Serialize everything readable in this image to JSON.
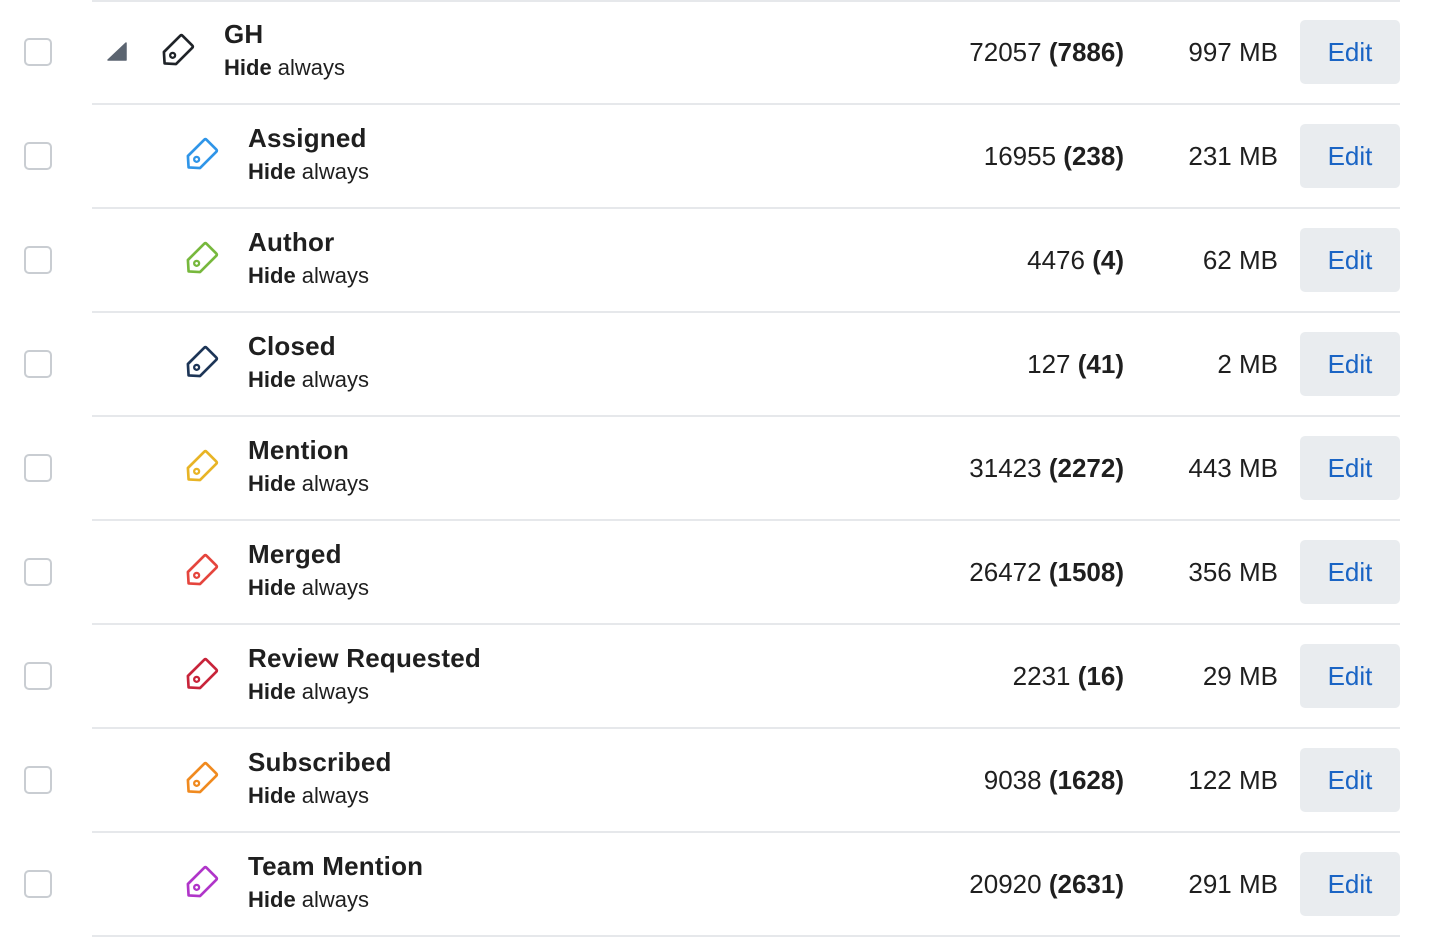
{
  "labels": [
    {
      "name": "GH",
      "visibility_strong": "Hide",
      "visibility_rest": " always",
      "count": "72057",
      "unread": "(7886)",
      "size": "997 MB",
      "edit_label": "Edit",
      "icon": "tag-outline-icon",
      "icon_color": "#1f2328",
      "is_parent": true
    },
    {
      "name": "Assigned",
      "visibility_strong": "Hide",
      "visibility_rest": " always",
      "count": "16955",
      "unread": "(238)",
      "size": "231 MB",
      "edit_label": "Edit",
      "icon": "tag-outline-icon",
      "icon_color": "#2f95e8",
      "is_parent": false
    },
    {
      "name": "Author",
      "visibility_strong": "Hide",
      "visibility_rest": " always",
      "count": "4476",
      "unread": "(4)",
      "size": "62 MB",
      "edit_label": "Edit",
      "icon": "tag-outline-icon",
      "icon_color": "#77b83d",
      "is_parent": false
    },
    {
      "name": "Closed",
      "visibility_strong": "Hide",
      "visibility_rest": " always",
      "count": "127",
      "unread": "(41)",
      "size": "2 MB",
      "edit_label": "Edit",
      "icon": "tag-outline-icon",
      "icon_color": "#1d3557",
      "is_parent": false
    },
    {
      "name": "Mention",
      "visibility_strong": "Hide",
      "visibility_rest": " always",
      "count": "31423",
      "unread": "(2272)",
      "size": "443 MB",
      "edit_label": "Edit",
      "icon": "tag-outline-icon",
      "icon_color": "#e8b425",
      "is_parent": false
    },
    {
      "name": "Merged",
      "visibility_strong": "Hide",
      "visibility_rest": " always",
      "count": "26472",
      "unread": "(1508)",
      "size": "356 MB",
      "edit_label": "Edit",
      "icon": "tag-outline-icon",
      "icon_color": "#e5453d",
      "is_parent": false
    },
    {
      "name": "Review Requested",
      "visibility_strong": "Hide",
      "visibility_rest": " always",
      "count": "2231",
      "unread": "(16)",
      "size": "29 MB",
      "edit_label": "Edit",
      "icon": "tag-outline-icon",
      "icon_color": "#c8243a",
      "is_parent": false
    },
    {
      "name": "Subscribed",
      "visibility_strong": "Hide",
      "visibility_rest": " always",
      "count": "9038",
      "unread": "(1628)",
      "size": "122 MB",
      "edit_label": "Edit",
      "icon": "tag-outline-icon",
      "icon_color": "#f08a1f",
      "is_parent": false
    },
    {
      "name": "Team Mention",
      "visibility_strong": "Hide",
      "visibility_rest": " always",
      "count": "20920",
      "unread": "(2631)",
      "size": "291 MB",
      "edit_label": "Edit",
      "icon": "tag-outline-icon",
      "icon_color": "#b035c9",
      "is_parent": false
    }
  ],
  "toggle_icon": "triangle-collapse-icon",
  "toggle_color": "#5b6470"
}
